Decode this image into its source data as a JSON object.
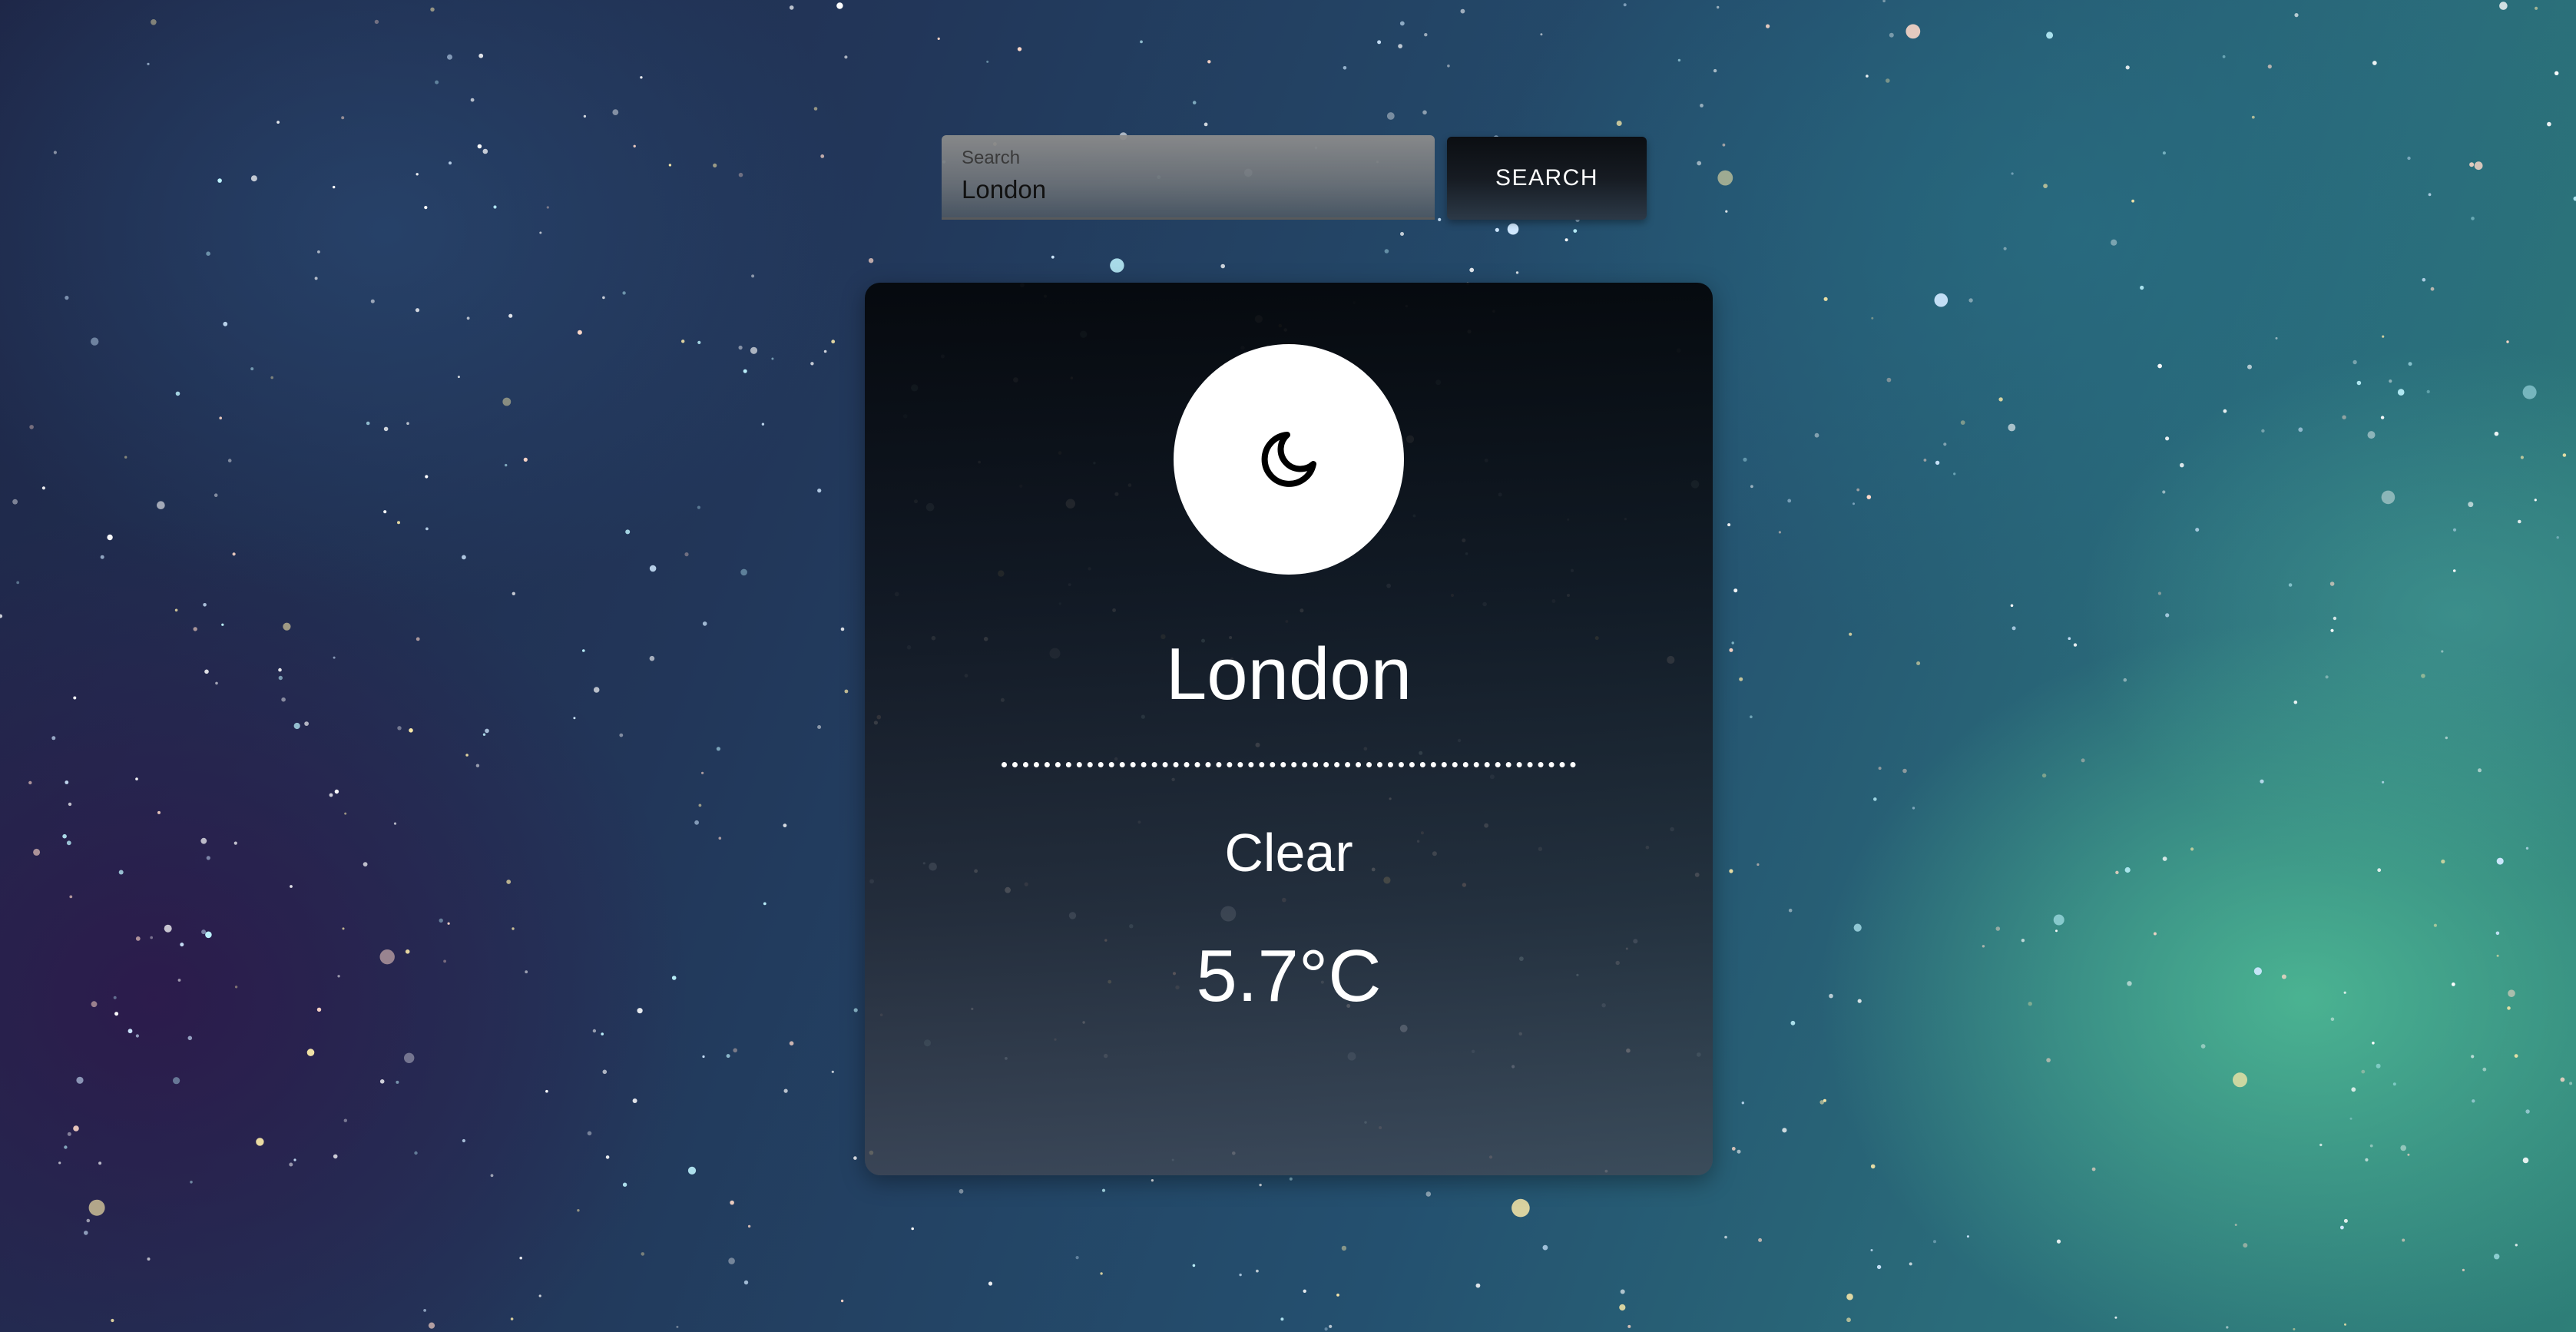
{
  "search": {
    "label": "Search",
    "value": "London",
    "button_label": "SEARCH"
  },
  "weather": {
    "icon": "moon-icon",
    "city": "London",
    "condition": "Clear",
    "temperature": "5.7°C"
  },
  "colors": {
    "card_text": "#ffffff",
    "icon_background": "#ffffff",
    "icon_stroke": "#000000"
  }
}
